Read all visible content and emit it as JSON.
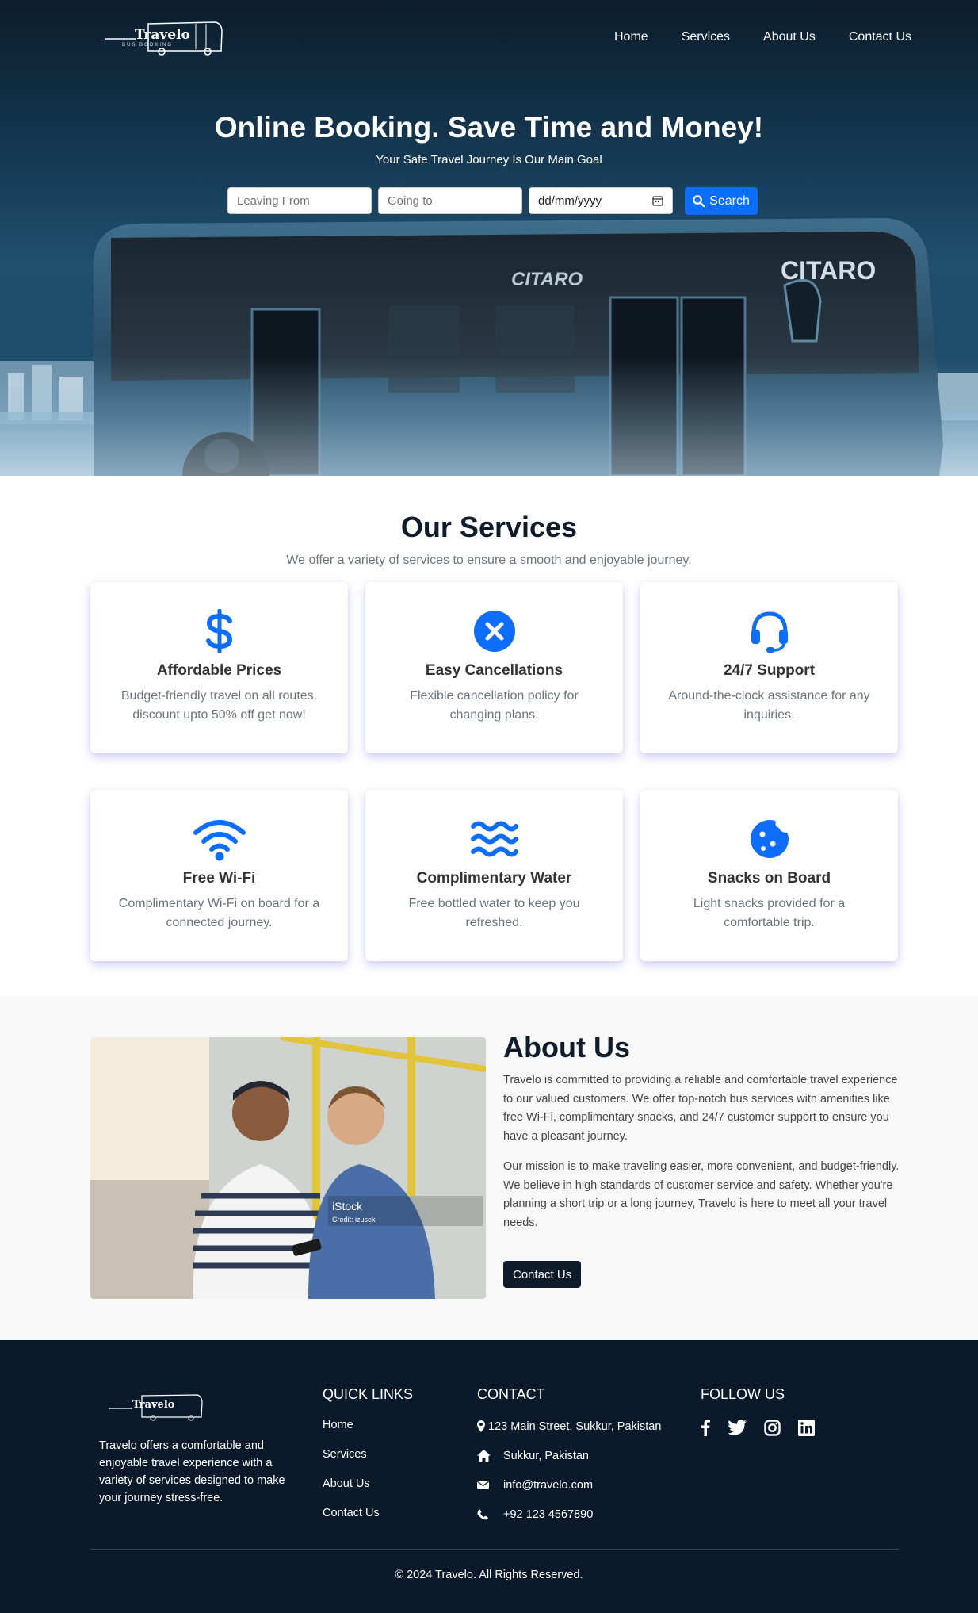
{
  "brand": {
    "name": "Travelo",
    "tagline": "BUS BOOKING"
  },
  "nav": {
    "items": [
      "Home",
      "Services",
      "About Us",
      "Contact Us"
    ]
  },
  "hero": {
    "title": "Online Booking. Save Time and Money!",
    "subtitle": "Your Safe Travel Journey Is Our Main Goal",
    "bus_brand_front": "CITARO",
    "bus_brand_side": "CITARO",
    "leaving_placeholder": "Leaving From",
    "going_placeholder": "Going to",
    "date_placeholder": "dd/mm/yyyy",
    "search_label": "Search"
  },
  "services": {
    "title": "Our Services",
    "subtitle": "We offer a variety of services to ensure a smooth and enjoyable journey.",
    "cards": [
      {
        "icon": "dollar-icon",
        "title": "Affordable Prices",
        "desc": "Budget-friendly travel on all routes. discount upto 50% off get now!"
      },
      {
        "icon": "cancel-circle-icon",
        "title": "Easy Cancellations",
        "desc": "Flexible cancellation policy for changing plans."
      },
      {
        "icon": "headset-icon",
        "title": "24/7 Support",
        "desc": "Around-the-clock assistance for any inquiries."
      },
      {
        "icon": "wifi-icon",
        "title": "Free Wi-Fi",
        "desc": "Complimentary Wi-Fi on board for a connected journey."
      },
      {
        "icon": "water-icon",
        "title": "Complimentary Water",
        "desc": "Free bottled water to keep you refreshed."
      },
      {
        "icon": "cookie-icon",
        "title": "Snacks on Board",
        "desc": "Light snacks provided for a comfortable trip."
      }
    ],
    "icon_color": "#0d6efd"
  },
  "about": {
    "title": "About Us",
    "p1": "Travelo is committed to providing a reliable and comfortable travel experience to our valued customers. We offer top-notch bus services with amenities like free Wi-Fi, complimentary snacks, and 24/7 customer support to ensure you have a pleasant journey.",
    "p2": "Our mission is to make traveling easier, more convenient, and budget-friendly. We believe in high standards of customer service and safety. Whether you're planning a short trip or a long journey, Travelo is here to meet all your travel needs.",
    "cta": "Contact Us",
    "image_watermark": "iStock",
    "image_credit": "Credit: izusek"
  },
  "footer": {
    "about": "Travelo offers a comfortable and enjoyable travel experience with a variety of services designed to make your journey stress-free.",
    "quick_links_title": "QUICK LINKS",
    "quick_links": [
      "Home",
      "Services",
      "About Us",
      "Contact Us"
    ],
    "contact_title": "CONTACT",
    "contact": [
      {
        "icon": "map-pin-icon",
        "text": "123 Main Street, Sukkur, Pakistan"
      },
      {
        "icon": "home-icon",
        "text": "Sukkur, Pakistan"
      },
      {
        "icon": "envelope-icon",
        "text": "info@travelo.com"
      },
      {
        "icon": "phone-icon",
        "text": "+92 123 4567890"
      }
    ],
    "follow_title": "FOLLOW US",
    "socials": [
      "facebook-icon",
      "twitter-icon",
      "instagram-icon",
      "linkedin-icon"
    ],
    "copyright": "© 2024 Travelo. All Rights Reserved."
  },
  "colors": {
    "primary": "#0d6efd",
    "dark": "#0d1b2a",
    "footer_bg": "#0a1a2b"
  }
}
